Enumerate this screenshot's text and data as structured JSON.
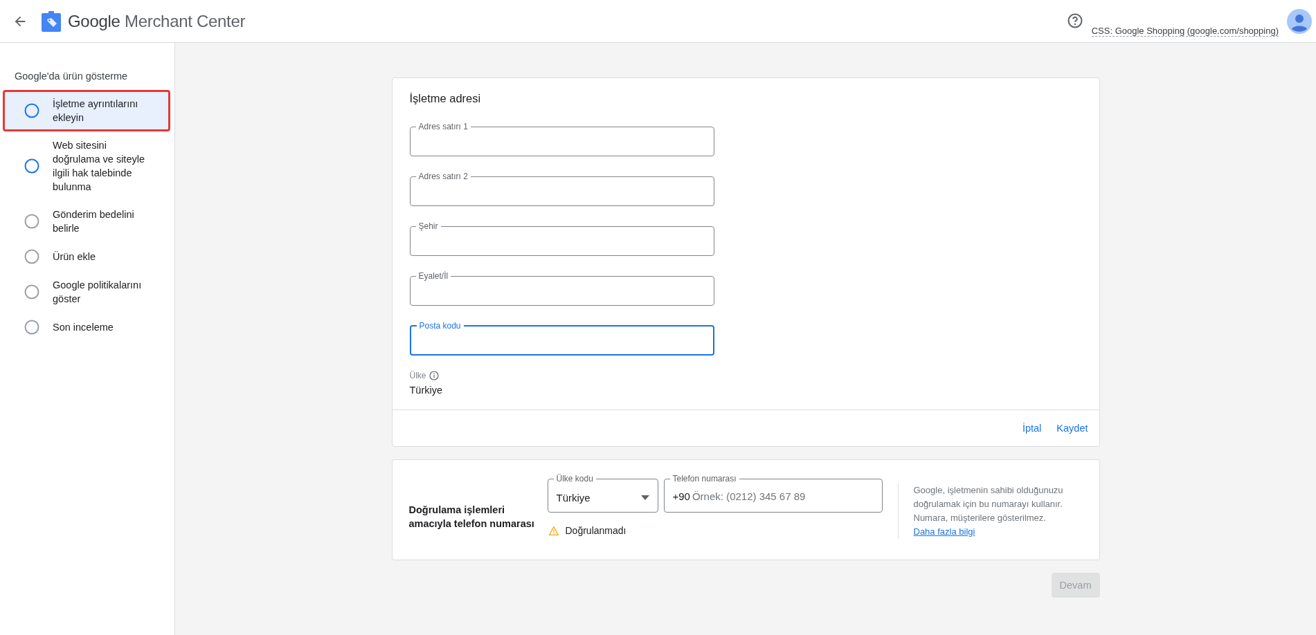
{
  "header": {
    "title_brand": "Google",
    "title_product": "Merchant Center",
    "account": "CSS: Google Shopping (google.com/shopping)"
  },
  "sidebar": {
    "heading": "Google'da ürün gösterme",
    "items": [
      {
        "label": "İşletme ayrıntılarını ekleyin",
        "selected": true,
        "available": true,
        "highlighted": true
      },
      {
        "label": "Web sitesini doğrulama ve siteyle ilgili hak talebinde bulunma",
        "selected": false,
        "available": true,
        "highlighted": false
      },
      {
        "label": "Gönderim bedelini belirle",
        "selected": false,
        "available": false,
        "highlighted": false
      },
      {
        "label": "Ürün ekle",
        "selected": false,
        "available": false,
        "highlighted": false
      },
      {
        "label": "Google politikalarını göster",
        "selected": false,
        "available": false,
        "highlighted": false
      },
      {
        "label": "Son inceleme",
        "selected": false,
        "available": false,
        "highlighted": false
      }
    ]
  },
  "address_card": {
    "title": "İşletme adresi",
    "fields": [
      {
        "label": "Adres satırı 1",
        "focused": false
      },
      {
        "label": "Adres satırı 2",
        "focused": false
      },
      {
        "label": "Şehir",
        "focused": false
      },
      {
        "label": "Eyalet/İl",
        "focused": false
      },
      {
        "label": "Posta kodu",
        "focused": true
      }
    ],
    "country_label": "Ülke",
    "country_value": "Türkiye",
    "cancel": "İptal",
    "save": "Kaydet"
  },
  "phone_card": {
    "label": "Doğrulama işlemleri amacıyla telefon numarası",
    "country_code": {
      "label": "Ülke kodu",
      "value": "Türkiye"
    },
    "phone": {
      "label": "Telefon numarası",
      "prefix": "+90",
      "placeholder": "Örnek: (0212) 345 67 89"
    },
    "status": "Doğrulanmadı",
    "help": "Google, işletmenin sahibi olduğunuzu doğrulamak için bu numarayı kullanır. Numara, müşterilere gösterilmez.",
    "help_link": "Daha fazla bilgi"
  },
  "continue_button": {
    "label": "Devam",
    "disabled": true
  }
}
